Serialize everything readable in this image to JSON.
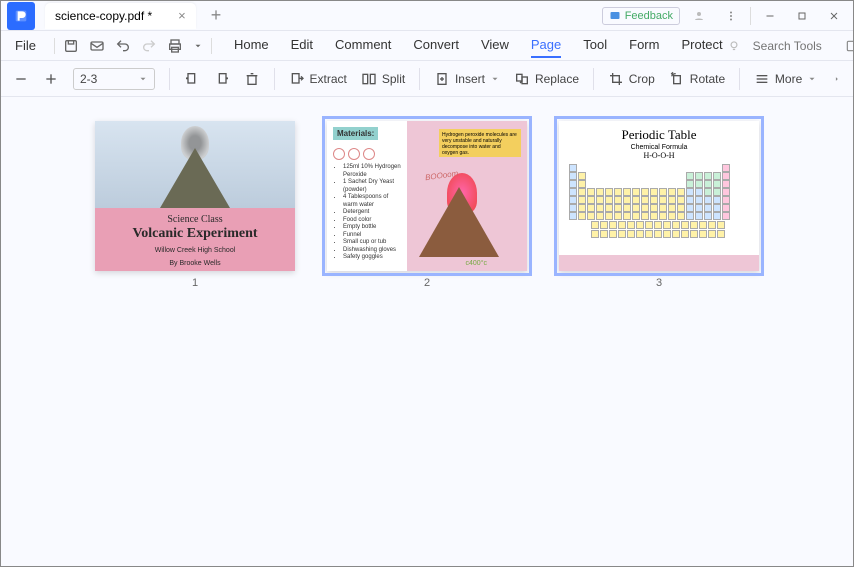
{
  "titlebar": {
    "app_glyph": "⎙",
    "document_title": "science-copy.pdf *",
    "feedback_label": "Feedback"
  },
  "menu": {
    "file_label": "File",
    "tabs": [
      "Home",
      "Edit",
      "Comment",
      "Convert",
      "View",
      "Page",
      "Tool",
      "Form",
      "Protect"
    ],
    "active_tab": "Page",
    "search_placeholder": "Search Tools"
  },
  "toolbar": {
    "page_range": "2-3",
    "extract_label": "Extract",
    "split_label": "Split",
    "insert_label": "Insert",
    "replace_label": "Replace",
    "crop_label": "Crop",
    "rotate_label": "Rotate",
    "more_label": "More"
  },
  "pages": {
    "p1": {
      "number": "1",
      "line1": "Science Class",
      "line2": "Volcanic Experiment",
      "sub1": "Willow Creek High School",
      "sub2": "By Brooke Wells"
    },
    "p2": {
      "number": "2",
      "materials_heading": "Materials:",
      "note_text": "Hydrogen peroxide molecules are very unstable and naturally decompose into water and oxygen gas.",
      "boom": "BOOoom",
      "temp": "c400°c",
      "items": [
        "125ml 10% Hydrogen Peroxide",
        "1 Sachet Dry Yeast (powder)",
        "4 Tablespoons of warm water",
        "Detergent",
        "Food color",
        "Empty bottle",
        "Funnel",
        "Small cup or tub",
        "Dishwashing gloves",
        "Safety goggles"
      ]
    },
    "p3": {
      "number": "3",
      "title": "Periodic Table",
      "chem_label": "Chemical Formula",
      "formula": "H-O-O-H"
    }
  }
}
